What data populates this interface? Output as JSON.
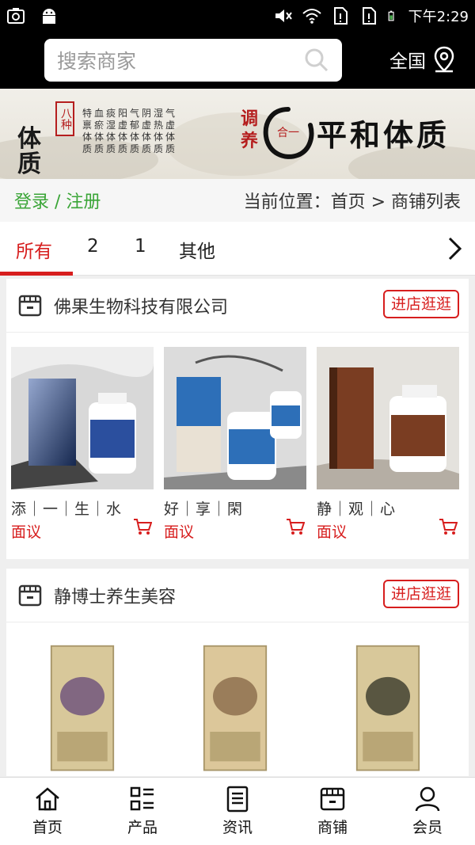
{
  "status_bar": {
    "time": "下午2:29",
    "icons": [
      "camera-icon",
      "android-icon",
      "mute-icon",
      "wifi-icon",
      "sim1-icon",
      "sim2-icon",
      "battery-icon"
    ]
  },
  "header": {
    "search_placeholder": "搜索商家",
    "region_label": "全国",
    "icons": [
      "search-icon",
      "location-pin-icon"
    ]
  },
  "banner": {
    "left_seal": "八种",
    "left_title": "体质",
    "grid_text": "特血痰阳气阴湿气\n禀瘀湿虚郁虚热虚\n体体体体体体体体\n质质质质质质质质",
    "right_side": "调养",
    "circle_text": "合一",
    "right_title": "平和体质"
  },
  "breadcrumb": {
    "login_label": "登录 / 注册",
    "location_text": "当前位置：首页 > 商铺列表"
  },
  "tabs": [
    {
      "label": "所有",
      "active": true
    },
    {
      "label": "2",
      "active": false
    },
    {
      "label": "1",
      "active": false
    },
    {
      "label": "其他",
      "active": false
    }
  ],
  "shops": [
    {
      "name": "佛果生物科技有限公司",
      "enter_label": "进店逛逛",
      "products": [
        {
          "name": "添｜一｜生｜水",
          "price": "面议",
          "color": "#2b4f9e"
        },
        {
          "name": "好｜享｜閑",
          "price": "面议",
          "color": "#2d6fb8"
        },
        {
          "name": "静｜观｜心",
          "price": "面议",
          "color": "#7a3d22"
        }
      ]
    },
    {
      "name": "静博士养生美容",
      "enter_label": "进店逛逛",
      "products": [
        {
          "name": "",
          "price": "",
          "color": "#c9b98a"
        },
        {
          "name": "",
          "price": "",
          "color": "#c9b98a"
        },
        {
          "name": "",
          "price": "",
          "color": "#c9b98a"
        }
      ]
    }
  ],
  "bottom_nav": [
    {
      "label": "首页",
      "icon": "home-icon"
    },
    {
      "label": "产品",
      "icon": "grid-list-icon"
    },
    {
      "label": "资讯",
      "icon": "news-icon"
    },
    {
      "label": "商铺",
      "icon": "store-icon"
    },
    {
      "label": "会员",
      "icon": "user-icon"
    }
  ],
  "colors": {
    "accent_red": "#d71e1e",
    "login_green": "#3aa537"
  }
}
